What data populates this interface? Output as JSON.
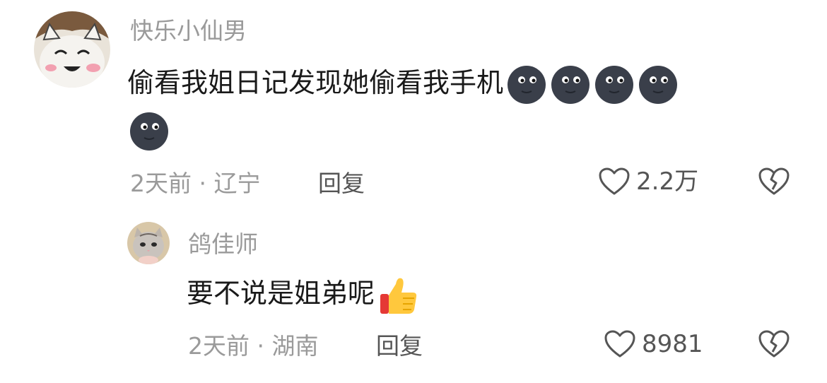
{
  "comments": [
    {
      "username": "快乐小仙男",
      "text": "偷看我姐日记发现她偷看我手机",
      "emojis": [
        "new-moon-face",
        "new-moon-face",
        "new-moon-face",
        "new-moon-face",
        "new-moon-face"
      ],
      "time": "2天前",
      "separator": "·",
      "location": "辽宁",
      "reply_label": "回复",
      "likes": "2.2万",
      "avatar_icon": "cartoon-cat-avatar"
    },
    {
      "username": "鸽佳师",
      "text": "要不说是姐弟呢",
      "emojis": [
        "thumbs-up"
      ],
      "time": "2天前",
      "separator": "·",
      "location": "湖南",
      "reply_label": "回复",
      "likes": "8981",
      "avatar_icon": "cat-photo-avatar"
    }
  ],
  "colors": {
    "username": "#9a9a9a",
    "text": "#1a1a1a",
    "meta": "#9a9a9a",
    "action": "#555555",
    "moon": "#3a3f4a"
  }
}
